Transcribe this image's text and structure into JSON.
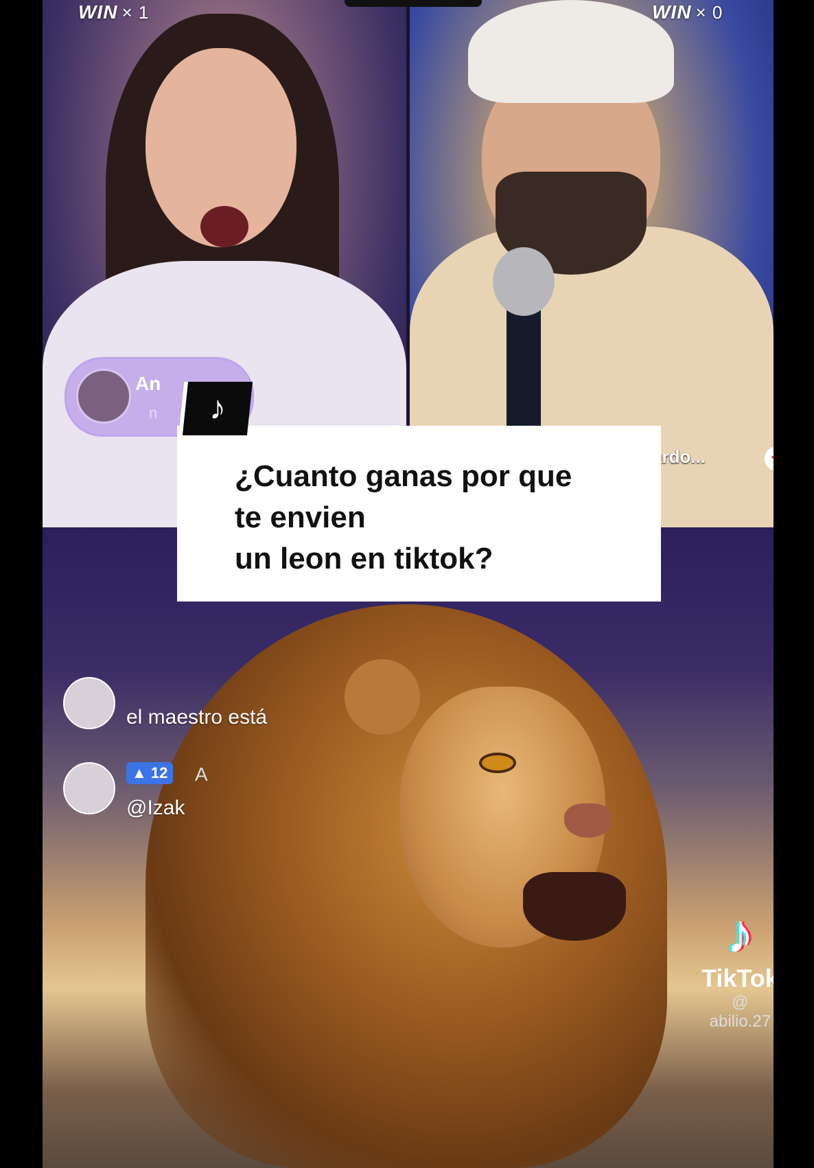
{
  "left_panel": {
    "win_label": "WIN",
    "win_count": "× 1"
  },
  "right_panel": {
    "win_label": "WIN",
    "win_count": "× 0",
    "guest_name": "ardo...",
    "follow_icon": "plus-icon"
  },
  "gift_banner": {
    "name": "An",
    "sub": "n"
  },
  "caption": {
    "icon": "tiktok-icon",
    "text": "¿Cuanto ganas por que\nte envien\nun leon en tiktok?"
  },
  "comments": [
    {
      "text": "el maestro está"
    },
    {
      "badge": "12",
      "name": "A",
      "text": "@Izak"
    }
  ],
  "watermark": {
    "brand": "TikTok",
    "user": "@ abilio.27"
  },
  "colors": {
    "accent_red": "#fe2c55",
    "accent_cyan": "#25f4ee",
    "badge_blue": "#3b74e6"
  }
}
